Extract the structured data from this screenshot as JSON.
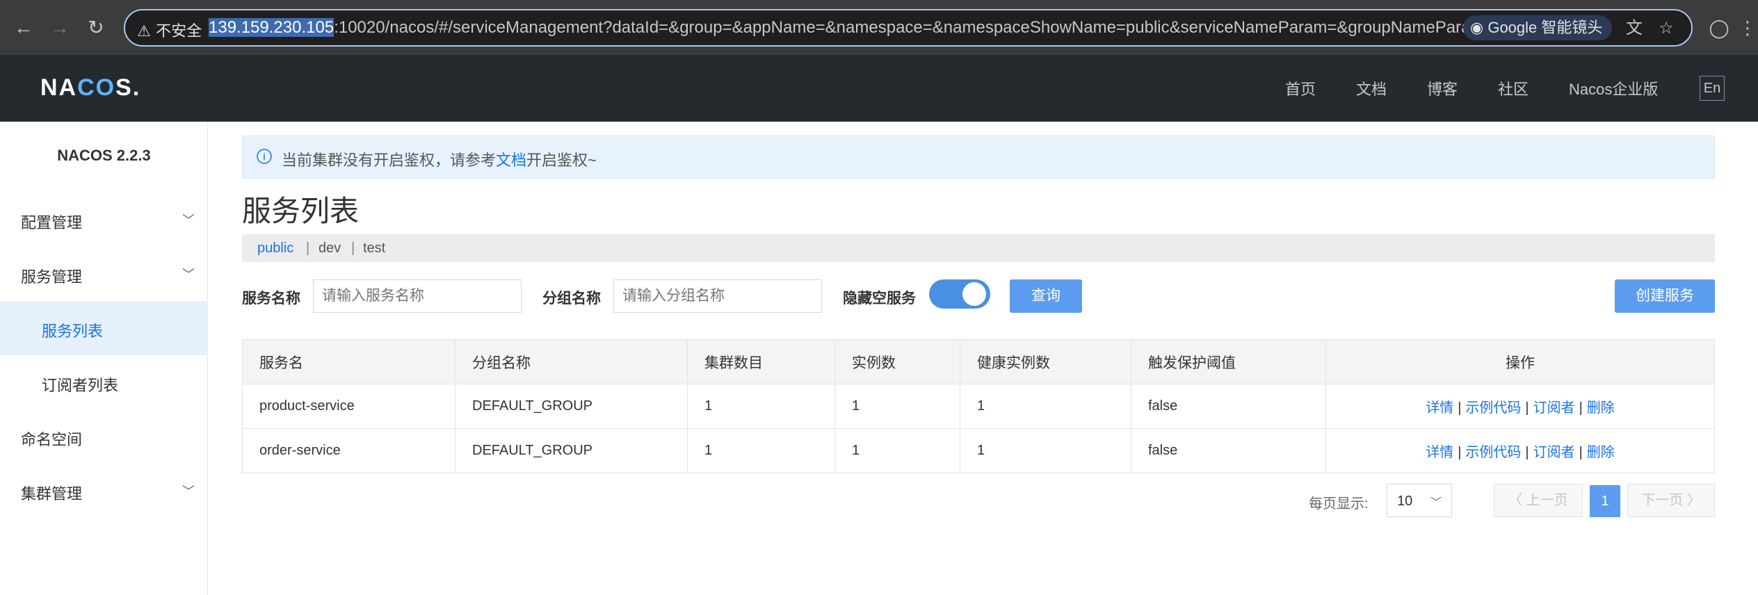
{
  "browser": {
    "back": "←",
    "forward": "→",
    "reload": "↻",
    "warn_icon": "⚠",
    "security_label": "不安全",
    "url_host": "139.159.230.105",
    "url_rest": ":10020/nacos/#/serviceManagement?dataId=&group=&appName=&namespace=&namespaceShowName=public&serviceNameParam=&groupNameParam=",
    "lens_label": "Google 智能镜头",
    "lens_icon": "◉",
    "translate_icon": "文",
    "star_icon": "☆",
    "profile_icon": "◯",
    "menu_icon": "⋮"
  },
  "header": {
    "logo_pre": "NA",
    "logo_o": "CO",
    "logo_post": "S.",
    "nav": [
      "首页",
      "文档",
      "博客",
      "社区",
      "Nacos企业版"
    ],
    "lang": "En"
  },
  "sidebar": {
    "title": "NACOS 2.2.3",
    "items": [
      {
        "label": "配置管理",
        "chevron": "﹀"
      },
      {
        "label": "服务管理",
        "chevron": "﹀"
      },
      {
        "label": "服务列表"
      },
      {
        "label": "订阅者列表"
      },
      {
        "label": "命名空间"
      },
      {
        "label": "集群管理",
        "chevron": "﹀"
      }
    ]
  },
  "notice": {
    "icon": "i",
    "text_before": "当前集群没有开启鉴权，请参考",
    "link": "文档",
    "text_after": "开启鉴权~"
  },
  "page_title": "服务列表",
  "namespaces": {
    "items": [
      "public",
      "dev",
      "test"
    ],
    "sep": "|"
  },
  "filters": {
    "service_name_label": "服务名称",
    "service_name_placeholder": "请输入服务名称",
    "group_name_label": "分组名称",
    "group_name_placeholder": "请输入分组名称",
    "hide_empty_label": "隐藏空服务",
    "hide_empty_on": true,
    "query_button": "查询",
    "create_button": "创建服务"
  },
  "table": {
    "headers": [
      "服务名",
      "分组名称",
      "集群数目",
      "实例数",
      "健康实例数",
      "触发保护阈值",
      "操作"
    ],
    "rows": [
      [
        "product-service",
        "DEFAULT_GROUP",
        "1",
        "1",
        "1",
        "false"
      ],
      [
        "order-service",
        "DEFAULT_GROUP",
        "1",
        "1",
        "1",
        "false"
      ]
    ],
    "actions": [
      "详情",
      "示例代码",
      "订阅者",
      "删除"
    ],
    "action_sep": "|"
  },
  "pagination": {
    "page_size_label": "每页显示:",
    "page_size": "10",
    "page_size_chevron": "﹀",
    "prev": "〈 上一页",
    "current": "1",
    "next": "下一页 〉"
  }
}
